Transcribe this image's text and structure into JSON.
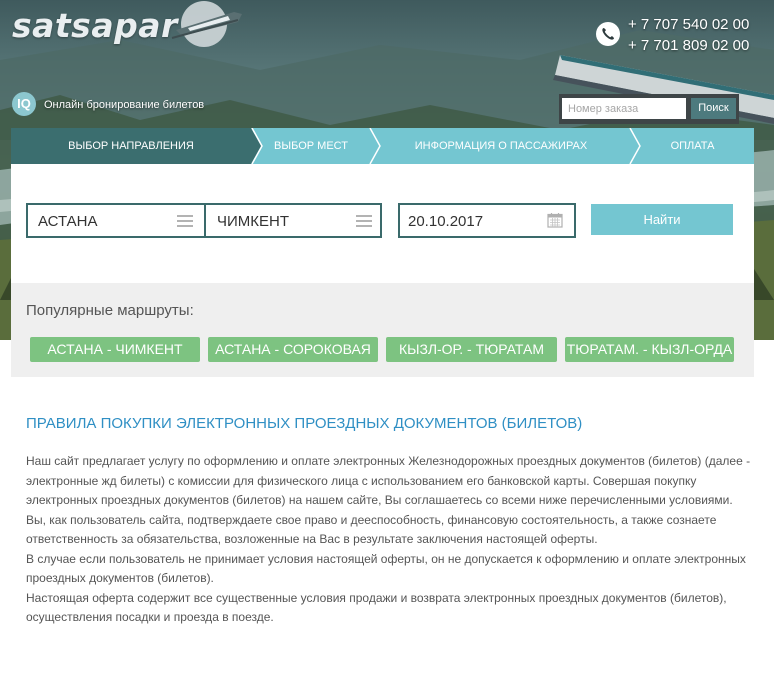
{
  "header": {
    "logo": "satsapar",
    "phones": [
      "+ 7 707 540 02 00",
      "+ 7 701 809 02 00"
    ],
    "tagline": "Онлайн бронирование билетов",
    "iq_badge": "IQ",
    "order_search": {
      "placeholder": "Номер заказа",
      "button": "Поиск"
    }
  },
  "steps": [
    "ВЫБОР НАПРАВЛЕНИЯ",
    "ВЫБОР МЕСТ",
    "ИНФОРМАЦИЯ О ПАССАЖИРАХ",
    "ОПЛАТА"
  ],
  "active_step": 0,
  "search": {
    "from": "АСТАНА",
    "to": "ЧИМКЕНТ",
    "date": "20.10.2017",
    "find_button": "Найти"
  },
  "popular": {
    "title": "Популярные маршруты:",
    "routes": [
      "АСТАНА - ЧИМКЕНТ",
      "АСТАНА - СОРОКОВАЯ",
      "КЫЗЛ-ОР. - ТЮРАТАМ",
      "ТЮРАТАМ. - КЫЗЛ-ОРДА"
    ]
  },
  "rules": {
    "title": "ПРАВИЛА ПОКУПКИ ЭЛЕКТРОННЫХ ПРОЕЗДНЫХ ДОКУМЕНТОВ (БИЛЕТОВ)",
    "paragraphs": [
      "Наш сайт предлагает услугу по оформлению и оплате электронных Железнодорожных проездных документов (билетов) (далее - электронные жд билеты) с комиссии для физического лица с использованием его банковской карты. Совершая покупку электронных проездных документов (билетов) на нашем сайте, Вы соглашаетесь со всеми ниже перечисленными условиями.",
      "Вы, как пользователь сайта, подтверждаете свое право и дееспособность, финансовую состоятельность, а также сознаете ответственность за обязательства, возложенные на Вас в результате заключения настоящей оферты.",
      "В случае если пользователь не принимает условия настоящей оферты, он не допускается к оформлению и оплате электронных проездных документов (билетов).",
      "Настоящая оферта содержит все существенные условия продажи и возврата электронных проездных документов (билетов), осуществления посадки и проезда в поезде."
    ]
  },
  "colors": {
    "teal_dark": "#3b6e6f",
    "teal_light": "#74c6d1",
    "green": "#7dc381",
    "link_blue": "#2f8fc4"
  }
}
